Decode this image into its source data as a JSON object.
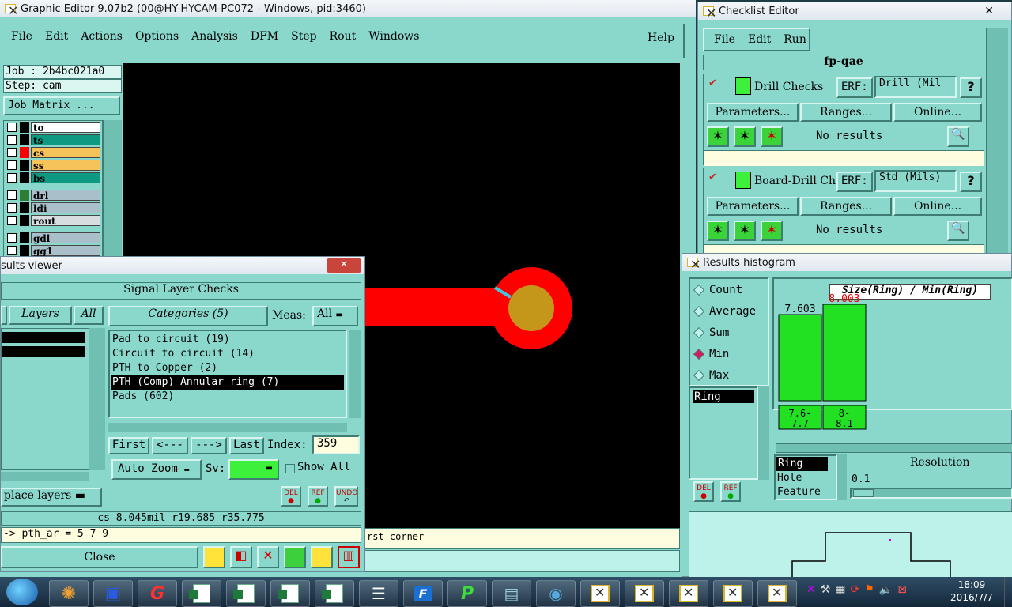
{
  "graphic_editor": {
    "title": "Graphic Editor 9.07b2 (00@HY-HYCAM-PC072 - Windows, pid:3460)",
    "menu": [
      "File",
      "Edit",
      "Actions",
      "Options",
      "Analysis",
      "DFM",
      "Step",
      "Rout",
      "Windows"
    ],
    "help": "Help",
    "job": "Job : 2b4bc021a0",
    "step": "Step: cam",
    "job_matrix": "Job Matrix ...",
    "layers": [
      {
        "name": "to",
        "color": "#ffffff"
      },
      {
        "name": "ts",
        "color": "#0e9a82"
      },
      {
        "name": "cs",
        "color": "#f6c25a"
      },
      {
        "name": "ss",
        "color": "#f6c25a"
      },
      {
        "name": "bs",
        "color": "#0e9a82"
      },
      {
        "name": "drl",
        "color": "#a9bfc9"
      },
      {
        "name": "ldi",
        "color": "#a9bfc9"
      },
      {
        "name": "rout",
        "color": "#d8dde0"
      },
      {
        "name": "gdl",
        "color": "#a9bfc9"
      },
      {
        "name": "gg1",
        "color": "#a9bfc9"
      }
    ],
    "canvas_status": "rst corner"
  },
  "checklist_editor": {
    "title": "Checklist Editor",
    "menu": [
      "File",
      "Edit",
      "Run"
    ],
    "name": "fp-qae",
    "checks": [
      {
        "name": "Drill Checks",
        "erf_label": "ERF:",
        "erf_value": "Drill (Mil",
        "help": "?",
        "params": "Parameters...",
        "ranges": "Ranges...",
        "online": "Online...",
        "results": "No results"
      },
      {
        "name": "Board-Drill Che",
        "erf_label": "ERF:",
        "erf_value": "Std (Mils)",
        "help": "?",
        "params": "Parameters...",
        "ranges": "Ranges...",
        "online": "Online...",
        "results": "No results"
      }
    ]
  },
  "results_viewer": {
    "title": "sults viewer",
    "header": "Signal Layer Checks",
    "layers_tab": "Layers",
    "all_tab": "All",
    "categories_tab": "Categories (5)",
    "meas_label": "Meas:",
    "meas_value": "All",
    "categories": [
      "Pad to circuit (19)",
      "Circuit to circuit (14)",
      "PTH to Copper (2)",
      "PTH (Comp) Annular ring (7)",
      "Pads (602)"
    ],
    "selected_index": 3,
    "nav": {
      "first": "First",
      "prev": "<---",
      "next": "--->",
      "last": "Last",
      "index_label": "Index:",
      "index_value": "359"
    },
    "auto_zoom": "Auto Zoom",
    "sv_label": "Sv:",
    "show_all": "Show All",
    "replace_layers": "place layers",
    "del": "DEL",
    "ref": "REF",
    "undo": "UNDO",
    "status": "cs 8.045mil  r19.685  r35.775",
    "command": "-> pth_ar = 5 7 9",
    "close": "Close"
  },
  "histogram": {
    "title": "Results histogram",
    "modes": [
      "Count",
      "Average",
      "Sum",
      "Min",
      "Max"
    ],
    "selected_mode": "Min",
    "list_item": "Ring",
    "chart_title": "Size(Ring) / Min(Ring)",
    "bars": [
      {
        "value": 7.603,
        "label": "7.603",
        "range": "7.6-\n7.7",
        "highlight": false
      },
      {
        "value": 8.003,
        "label": "8.003",
        "range": "8-\n8.1",
        "highlight": true
      }
    ],
    "attr_items": [
      "Ring",
      "Hole",
      "Feature"
    ],
    "resolution_label": "Resolution",
    "resolution_value": "0.1",
    "del": "DEL",
    "ref": "REF"
  },
  "taskbar": {
    "time": "18:09",
    "date": "2016/7/7"
  }
}
